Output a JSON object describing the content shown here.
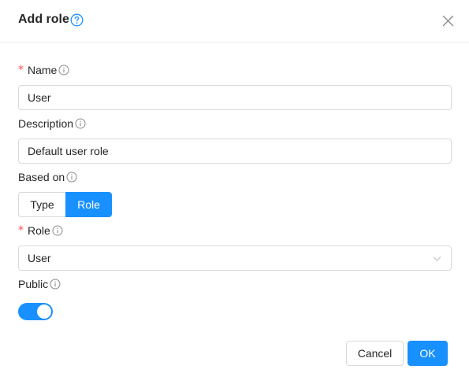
{
  "dialog": {
    "title": "Add role",
    "close_icon": "close-icon",
    "help_icon": "question-circle-icon"
  },
  "form": {
    "name": {
      "label": "Name",
      "required_mark": "*",
      "value": "User"
    },
    "description": {
      "label": "Description",
      "value": "Default user role"
    },
    "based_on": {
      "label": "Based on",
      "options": [
        "Type",
        "Role"
      ],
      "selected": "Role"
    },
    "role": {
      "label": "Role",
      "required_mark": "*",
      "value": "User"
    },
    "public": {
      "label": "Public",
      "enabled": true
    }
  },
  "footer": {
    "cancel_label": "Cancel",
    "ok_label": "OK"
  },
  "colors": {
    "primary": "#1890ff",
    "required": "#ff4d4f",
    "border": "#d9d9d9",
    "text": "#262626",
    "info_icon": "#8c8c8c"
  }
}
